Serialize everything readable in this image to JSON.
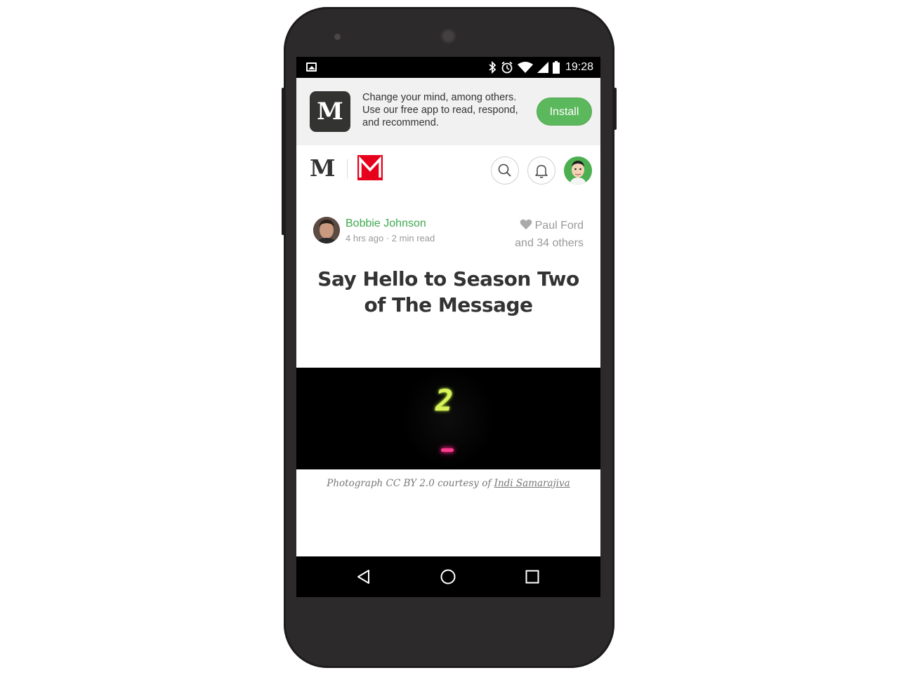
{
  "statusbar": {
    "time": "19:28",
    "icons": [
      "image-icon",
      "bluetooth-icon",
      "alarm-icon",
      "wifi-icon",
      "signal-icon",
      "battery-icon"
    ]
  },
  "banner": {
    "logo_letter": "M",
    "text": "Change your mind, among others. Use our free app to read, respond, and recommend.",
    "install_label": "Install"
  },
  "topnav": {
    "logo_letter": "M",
    "icons": [
      "search-icon",
      "bell-icon"
    ]
  },
  "post": {
    "author": "Bobbie Johnson",
    "time_ago": "4 hrs ago",
    "separator": "·",
    "read_time": "2 min read",
    "recommended_by": "Paul Ford",
    "recommended_others": "and 34 others",
    "title": "Say Hello to Season Two of The Message",
    "image_digit": "2",
    "caption_prefix": "Photograph CC BY 2.0 courtesy of",
    "caption_link": "Indi Samarajiva"
  },
  "colors": {
    "accent_green": "#5cb85c",
    "author_green": "#3ea94f",
    "brand_red": "#e6001b",
    "phone_body": "#2d2a2b"
  },
  "navbar": {
    "icons": [
      "back-icon",
      "home-icon",
      "recents-icon"
    ]
  }
}
